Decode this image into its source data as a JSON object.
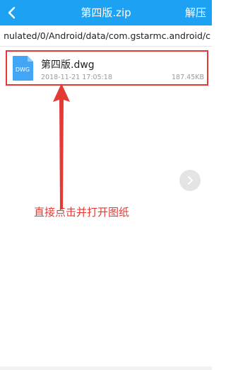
{
  "header": {
    "title": "第四版.zip",
    "action_label": "解压",
    "back_icon": "chevron-left-icon",
    "bar_color": "#1da1f2"
  },
  "path": {
    "text": "nulated/0/Android/data/com.gstarmc.android/c"
  },
  "files": [
    {
      "name": "第四版.dwg",
      "icon": "dwg-file-icon",
      "icon_label": "DWG",
      "date": "2018-11-21 17:05:18",
      "size": "187.45KB"
    }
  ],
  "annotation": {
    "text": "直接点击并打开图纸",
    "color": "#e53935"
  },
  "side_button": {
    "icon": "chevron-right-icon"
  }
}
